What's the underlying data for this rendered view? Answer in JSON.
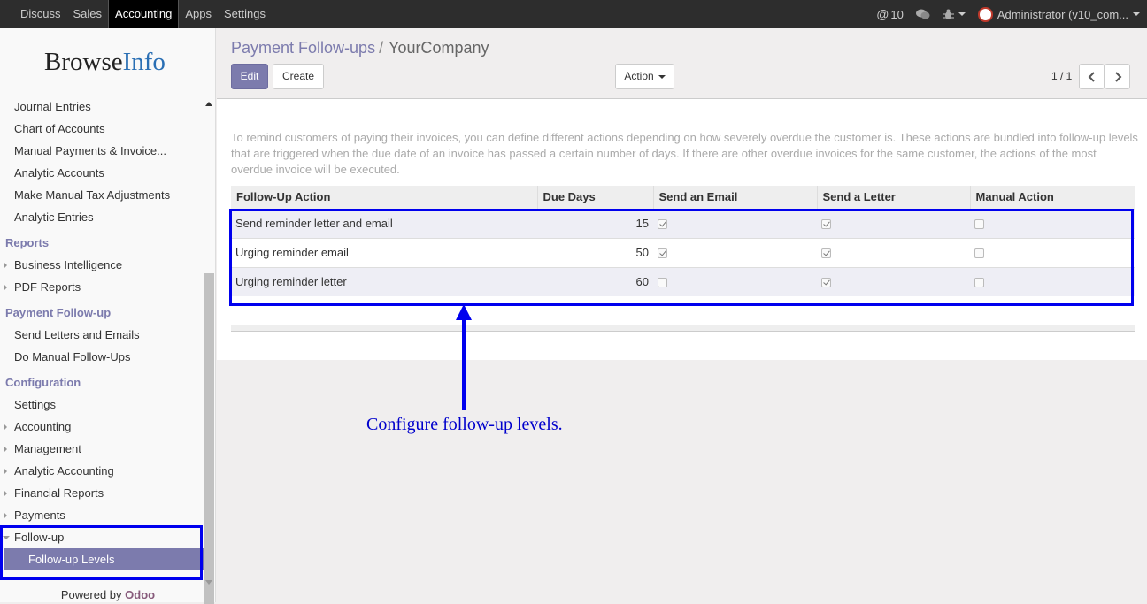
{
  "topbar": {
    "menu": [
      "Discuss",
      "Sales",
      "Accounting",
      "Apps",
      "Settings"
    ],
    "active": "Accounting",
    "mentions": "10",
    "user": "Administrator (v10_com..."
  },
  "sidebar": {
    "logo_a": "Browse",
    "logo_b": "Info",
    "entries": [
      "Journal Entries",
      "Chart of Accounts",
      "Manual Payments & Invoice...",
      "Analytic Accounts",
      "Make Manual Tax Adjustments",
      "Analytic Entries"
    ],
    "reports_header": "Reports",
    "reports": [
      "Business Intelligence",
      "PDF Reports"
    ],
    "followup_header": "Payment Follow-up",
    "followup": [
      "Send Letters and Emails",
      "Do Manual Follow-Ups"
    ],
    "config_header": "Configuration",
    "config_settings": "Settings",
    "config": [
      "Accounting",
      "Management",
      "Analytic Accounting",
      "Financial Reports",
      "Payments"
    ],
    "followup_group": "Follow-up",
    "followup_levels": "Follow-up Levels",
    "powered_by": "Powered by",
    "odoo": "Odoo"
  },
  "control_panel": {
    "breadcrumb_parent": "Payment Follow-ups",
    "breadcrumb_sep": "/",
    "breadcrumb_current": "YourCompany",
    "edit": "Edit",
    "create": "Create",
    "action": "Action",
    "pager": "1 / 1"
  },
  "sheet": {
    "help": "To remind customers of paying their invoices, you can define different actions depending on how severely overdue the customer is. These actions are bundled into follow-up levels that are triggered when the due date of an invoice has passed a certain number of days. If there are other overdue invoices for the same customer, the actions of the most overdue invoice will be executed.",
    "columns": [
      "Follow-Up Action",
      "Due Days",
      "Send an Email",
      "Send a Letter",
      "Manual Action"
    ],
    "rows": [
      {
        "action": "Send reminder letter and email",
        "days": "15",
        "email": true,
        "letter": true,
        "manual": false
      },
      {
        "action": "Urging reminder email",
        "days": "50",
        "email": true,
        "letter": true,
        "manual": false
      },
      {
        "action": "Urging reminder letter",
        "days": "60",
        "email": false,
        "letter": true,
        "manual": false
      }
    ]
  },
  "annotation": "Configure follow-up levels.",
  "colors": {
    "accent": "#7c7bad",
    "highlight": "#0000ee"
  }
}
